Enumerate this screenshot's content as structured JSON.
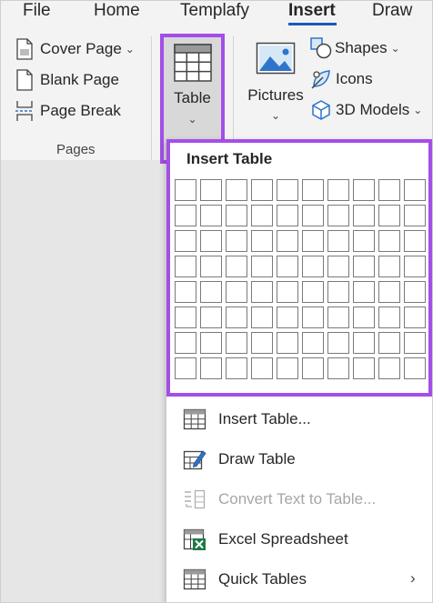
{
  "tabs": [
    {
      "label": "File"
    },
    {
      "label": "Home"
    },
    {
      "label": "Templafy"
    },
    {
      "label": "Insert",
      "active": true
    },
    {
      "label": "Draw"
    }
  ],
  "ribbon": {
    "pages_group": {
      "items": [
        {
          "label": "Cover Page",
          "icon": "cover-page-icon",
          "has_dropdown": true
        },
        {
          "label": "Blank Page",
          "icon": "blank-page-icon"
        },
        {
          "label": "Page Break",
          "icon": "page-break-icon"
        }
      ],
      "group_label": "Pages"
    },
    "table_button": {
      "label": "Table",
      "icon": "table-icon",
      "has_dropdown": true
    },
    "pictures_button": {
      "label": "Pictures",
      "icon": "picture-icon",
      "has_dropdown": true
    },
    "illustrations": [
      {
        "label": "Shapes",
        "icon": "shapes-icon",
        "has_dropdown": true
      },
      {
        "label": "Icons",
        "icon": "icons-icon"
      },
      {
        "label": "3D Models",
        "icon": "3d-models-icon",
        "has_dropdown": true
      }
    ]
  },
  "insert_table_menu": {
    "title": "Insert Table",
    "grid_columns": 10,
    "grid_rows": 8,
    "items": [
      {
        "label": "Insert Table...",
        "icon": "insert-table-icon",
        "enabled": true
      },
      {
        "label": "Draw Table",
        "icon": "draw-table-icon",
        "enabled": true
      },
      {
        "label": "Convert Text to Table...",
        "icon": "convert-text-to-table-icon",
        "enabled": false
      },
      {
        "label": "Excel Spreadsheet",
        "icon": "excel-spreadsheet-icon",
        "enabled": true
      },
      {
        "label": "Quick Tables",
        "icon": "quick-tables-icon",
        "enabled": true,
        "has_submenu": true
      }
    ]
  },
  "colors": {
    "highlight_border": "#a44ee8",
    "tab_underline": "#185abd",
    "excel_green": "#1d7a44",
    "draw_pencil": "#2e74c9"
  }
}
